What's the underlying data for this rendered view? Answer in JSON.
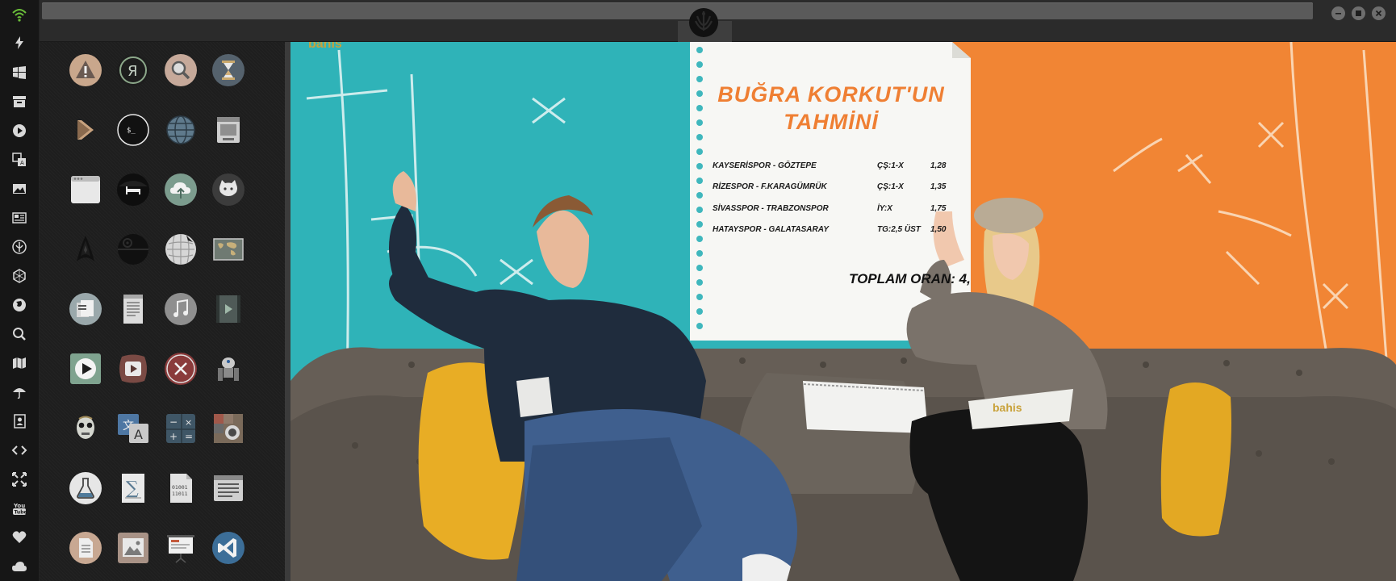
{
  "window": {
    "buttons": {
      "minimize": "minimize",
      "maximize": "maximize",
      "close": "close"
    }
  },
  "dock": {
    "items": [
      {
        "icon": "wifi-icon"
      },
      {
        "icon": "lightning-icon"
      },
      {
        "icon": "windows-icon"
      },
      {
        "icon": "archive-icon"
      },
      {
        "icon": "play-icon"
      },
      {
        "icon": "translate-icon"
      },
      {
        "icon": "image-icon"
      },
      {
        "icon": "news-icon"
      },
      {
        "icon": "rebel-icon"
      },
      {
        "icon": "hexagon-icon"
      },
      {
        "icon": "globe-icon"
      },
      {
        "icon": "search-icon"
      },
      {
        "icon": "map-icon"
      },
      {
        "icon": "umbrella-icon"
      },
      {
        "icon": "contacts-icon"
      },
      {
        "icon": "code-icon"
      },
      {
        "icon": "fullscreen-icon"
      },
      {
        "icon": "youtube-icon"
      },
      {
        "icon": "heart-icon"
      },
      {
        "icon": "cloud-icon"
      }
    ]
  },
  "launcher": {
    "apps": [
      {
        "name": "warning-icon"
      },
      {
        "name": "yandex-icon"
      },
      {
        "name": "search-icon"
      },
      {
        "name": "hourglass-icon"
      },
      {
        "name": "chevron-right-icon"
      },
      {
        "name": "terminal-icon"
      },
      {
        "name": "network-globe-icon"
      },
      {
        "name": "disk-icon"
      },
      {
        "name": "window-icon"
      },
      {
        "name": "bed-icon"
      },
      {
        "name": "cloud-upload-icon"
      },
      {
        "name": "github-icon"
      },
      {
        "name": "starfleet-icon"
      },
      {
        "name": "death-star-icon"
      },
      {
        "name": "wikipedia-icon"
      },
      {
        "name": "world-map-icon"
      },
      {
        "name": "document-stack-icon"
      },
      {
        "name": "text-file-icon"
      },
      {
        "name": "music-icon"
      },
      {
        "name": "video-file-icon"
      },
      {
        "name": "play-video-icon"
      },
      {
        "name": "video-player-icon"
      },
      {
        "name": "close-circle-icon"
      },
      {
        "name": "droid-icon"
      },
      {
        "name": "c3po-icon"
      },
      {
        "name": "translate-app-icon"
      },
      {
        "name": "calculator-icon"
      },
      {
        "name": "screenshot-icon"
      },
      {
        "name": "flask-icon"
      },
      {
        "name": "math-icon"
      },
      {
        "name": "binary-file-icon"
      },
      {
        "name": "text-editor-icon"
      },
      {
        "name": "document-icon"
      },
      {
        "name": "photo-icon"
      },
      {
        "name": "presentation-icon"
      },
      {
        "name": "vscode-icon"
      }
    ]
  },
  "video": {
    "logo_top": "bahis",
    "pillow_logo": "bahis",
    "paper": {
      "title_line1": "BUĞRA KORKUT'UN",
      "title_line2": "TAHMİNİ",
      "bets": [
        {
          "match": "KAYSERİSPOR - GÖZTEPE",
          "pick": "ÇŞ:1-X",
          "odds": "1,28"
        },
        {
          "match": "RİZESPOR - F.KARAGÜMRÜK",
          "pick": "ÇŞ:1-X",
          "odds": "1,35"
        },
        {
          "match": "SİVASSPOR - TRABZONSPOR",
          "pick": "İY:X",
          "odds": "1,75"
        },
        {
          "match": "HATAYSPOR - GALATASARAY",
          "pick": "TG:2,5 ÜST",
          "odds": "1,50"
        }
      ],
      "total": "TOPLAM ORAN: 4,"
    }
  },
  "colors": {
    "accent_orange": "#ef7f33",
    "teal": "#2fb3b8",
    "dock_bg": "#161616",
    "wifi_green": "#6bbf3a"
  }
}
